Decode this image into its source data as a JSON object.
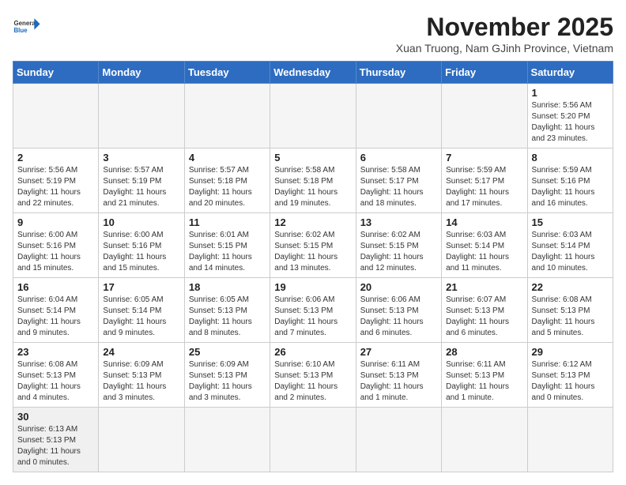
{
  "header": {
    "logo_general": "General",
    "logo_blue": "Blue",
    "month_title": "November 2025",
    "subtitle": "Xuan Truong, Nam GJinh Province, Vietnam"
  },
  "weekdays": [
    "Sunday",
    "Monday",
    "Tuesday",
    "Wednesday",
    "Thursday",
    "Friday",
    "Saturday"
  ],
  "weeks": [
    [
      {
        "day": "",
        "info": ""
      },
      {
        "day": "",
        "info": ""
      },
      {
        "day": "",
        "info": ""
      },
      {
        "day": "",
        "info": ""
      },
      {
        "day": "",
        "info": ""
      },
      {
        "day": "",
        "info": ""
      },
      {
        "day": "1",
        "info": "Sunrise: 5:56 AM\nSunset: 5:20 PM\nDaylight: 11 hours\nand 23 minutes."
      }
    ],
    [
      {
        "day": "2",
        "info": "Sunrise: 5:56 AM\nSunset: 5:19 PM\nDaylight: 11 hours\nand 22 minutes."
      },
      {
        "day": "3",
        "info": "Sunrise: 5:57 AM\nSunset: 5:19 PM\nDaylight: 11 hours\nand 21 minutes."
      },
      {
        "day": "4",
        "info": "Sunrise: 5:57 AM\nSunset: 5:18 PM\nDaylight: 11 hours\nand 20 minutes."
      },
      {
        "day": "5",
        "info": "Sunrise: 5:58 AM\nSunset: 5:18 PM\nDaylight: 11 hours\nand 19 minutes."
      },
      {
        "day": "6",
        "info": "Sunrise: 5:58 AM\nSunset: 5:17 PM\nDaylight: 11 hours\nand 18 minutes."
      },
      {
        "day": "7",
        "info": "Sunrise: 5:59 AM\nSunset: 5:17 PM\nDaylight: 11 hours\nand 17 minutes."
      },
      {
        "day": "8",
        "info": "Sunrise: 5:59 AM\nSunset: 5:16 PM\nDaylight: 11 hours\nand 16 minutes."
      }
    ],
    [
      {
        "day": "9",
        "info": "Sunrise: 6:00 AM\nSunset: 5:16 PM\nDaylight: 11 hours\nand 15 minutes."
      },
      {
        "day": "10",
        "info": "Sunrise: 6:00 AM\nSunset: 5:16 PM\nDaylight: 11 hours\nand 15 minutes."
      },
      {
        "day": "11",
        "info": "Sunrise: 6:01 AM\nSunset: 5:15 PM\nDaylight: 11 hours\nand 14 minutes."
      },
      {
        "day": "12",
        "info": "Sunrise: 6:02 AM\nSunset: 5:15 PM\nDaylight: 11 hours\nand 13 minutes."
      },
      {
        "day": "13",
        "info": "Sunrise: 6:02 AM\nSunset: 5:15 PM\nDaylight: 11 hours\nand 12 minutes."
      },
      {
        "day": "14",
        "info": "Sunrise: 6:03 AM\nSunset: 5:14 PM\nDaylight: 11 hours\nand 11 minutes."
      },
      {
        "day": "15",
        "info": "Sunrise: 6:03 AM\nSunset: 5:14 PM\nDaylight: 11 hours\nand 10 minutes."
      }
    ],
    [
      {
        "day": "16",
        "info": "Sunrise: 6:04 AM\nSunset: 5:14 PM\nDaylight: 11 hours\nand 9 minutes."
      },
      {
        "day": "17",
        "info": "Sunrise: 6:05 AM\nSunset: 5:14 PM\nDaylight: 11 hours\nand 9 minutes."
      },
      {
        "day": "18",
        "info": "Sunrise: 6:05 AM\nSunset: 5:13 PM\nDaylight: 11 hours\nand 8 minutes."
      },
      {
        "day": "19",
        "info": "Sunrise: 6:06 AM\nSunset: 5:13 PM\nDaylight: 11 hours\nand 7 minutes."
      },
      {
        "day": "20",
        "info": "Sunrise: 6:06 AM\nSunset: 5:13 PM\nDaylight: 11 hours\nand 6 minutes."
      },
      {
        "day": "21",
        "info": "Sunrise: 6:07 AM\nSunset: 5:13 PM\nDaylight: 11 hours\nand 6 minutes."
      },
      {
        "day": "22",
        "info": "Sunrise: 6:08 AM\nSunset: 5:13 PM\nDaylight: 11 hours\nand 5 minutes."
      }
    ],
    [
      {
        "day": "23",
        "info": "Sunrise: 6:08 AM\nSunset: 5:13 PM\nDaylight: 11 hours\nand 4 minutes."
      },
      {
        "day": "24",
        "info": "Sunrise: 6:09 AM\nSunset: 5:13 PM\nDaylight: 11 hours\nand 3 minutes."
      },
      {
        "day": "25",
        "info": "Sunrise: 6:09 AM\nSunset: 5:13 PM\nDaylight: 11 hours\nand 3 minutes."
      },
      {
        "day": "26",
        "info": "Sunrise: 6:10 AM\nSunset: 5:13 PM\nDaylight: 11 hours\nand 2 minutes."
      },
      {
        "day": "27",
        "info": "Sunrise: 6:11 AM\nSunset: 5:13 PM\nDaylight: 11 hours\nand 1 minute."
      },
      {
        "day": "28",
        "info": "Sunrise: 6:11 AM\nSunset: 5:13 PM\nDaylight: 11 hours\nand 1 minute."
      },
      {
        "day": "29",
        "info": "Sunrise: 6:12 AM\nSunset: 5:13 PM\nDaylight: 11 hours\nand 0 minutes."
      }
    ],
    [
      {
        "day": "30",
        "info": "Sunrise: 6:13 AM\nSunset: 5:13 PM\nDaylight: 11 hours\nand 0 minutes."
      },
      {
        "day": "",
        "info": ""
      },
      {
        "day": "",
        "info": ""
      },
      {
        "day": "",
        "info": ""
      },
      {
        "day": "",
        "info": ""
      },
      {
        "day": "",
        "info": ""
      },
      {
        "day": "",
        "info": ""
      }
    ]
  ]
}
